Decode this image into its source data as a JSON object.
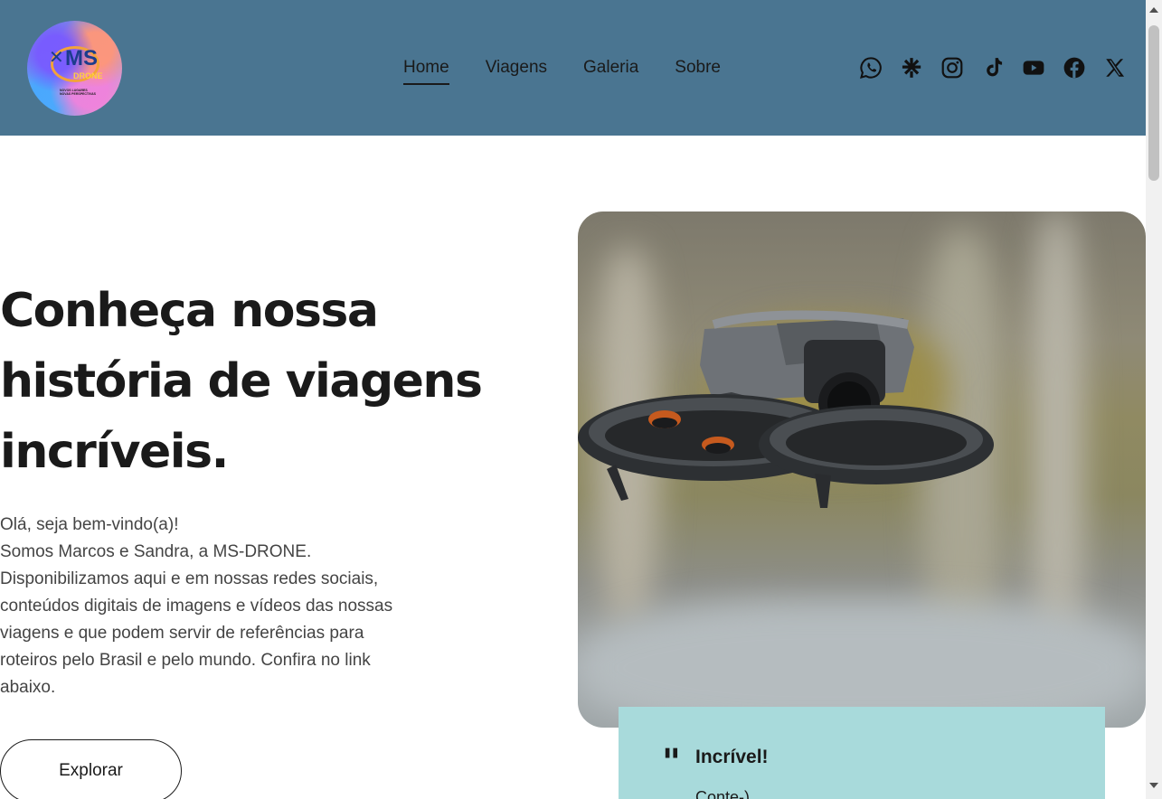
{
  "header": {
    "logo": {
      "text_main": "MS",
      "text_sub": "DRONE",
      "tagline": "NOVOS LUGARES NOVAS PERSPECTIVAS",
      "icon": "logo-icon"
    },
    "nav": [
      {
        "label": "Home",
        "active": true
      },
      {
        "label": "Viagens",
        "active": false
      },
      {
        "label": "Galeria",
        "active": false
      },
      {
        "label": "Sobre",
        "active": false
      }
    ],
    "social": [
      "whatsapp-icon",
      "linktree-icon",
      "instagram-icon",
      "tiktok-icon",
      "youtube-icon",
      "facebook-icon",
      "x-icon"
    ],
    "background_color": "#4a7591"
  },
  "hero": {
    "title_lines": [
      "Conheça nossa",
      "história de viagens",
      "incríveis."
    ],
    "text_lines": [
      "Olá, seja bem-vindo(a)!",
      "Somos Marcos e Sandra, a MS-DRONE.",
      "Disponibilizamos aqui e em nossas redes sociais,",
      "conteúdos digitais de imagens e vídeos das nossas",
      "viagens e que podem servir de referências para",
      "roteiros pelo Brasil e pelo mundo. Confira no link",
      "abaixo."
    ],
    "button_label": "Explorar",
    "image_alt": "drone-photo"
  },
  "testimonial": {
    "title": "Incrível!",
    "subtitle": "Conte-)",
    "background_color": "#a8dadb"
  }
}
